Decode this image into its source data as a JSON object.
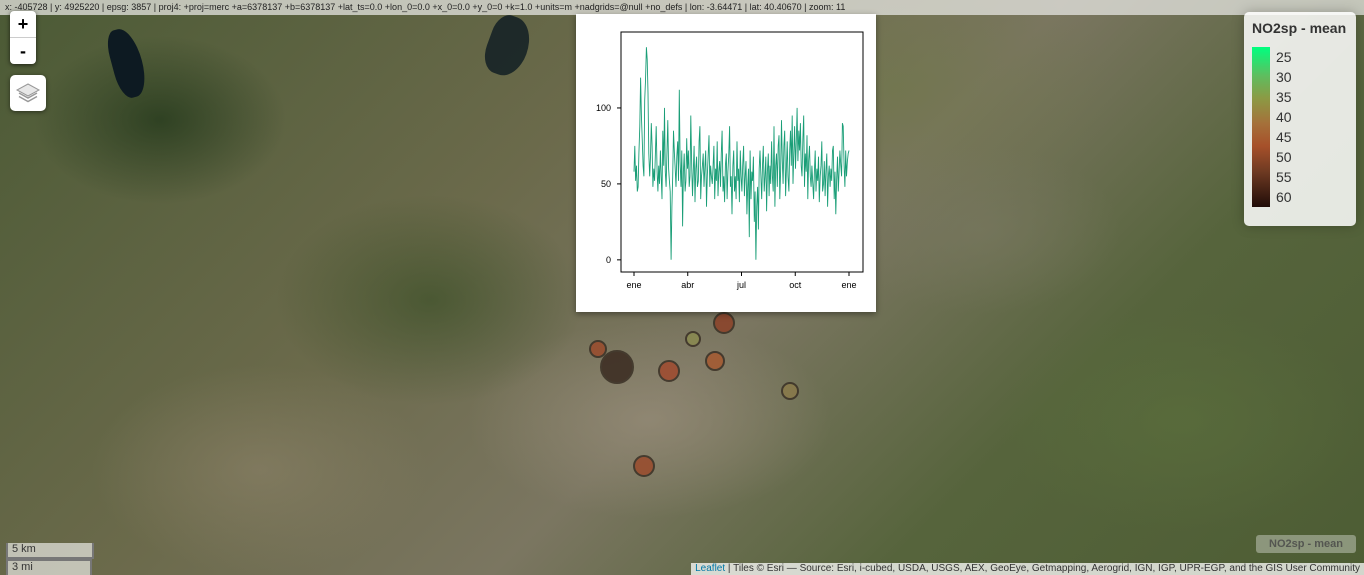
{
  "coordinates_text": "x: -405728 | y: 4925220 | epsg: 3857 | proj4: +proj=merc +a=6378137 +b=6378137 +lat_ts=0.0 +lon_0=0.0 +x_0=0.0 +y_0=0 +k=1.0 +units=m +nadgrids=@null +no_defs | lon: -3.64471 | lat: 40.40670 | zoom: 11",
  "zoom": {
    "in_label": "+",
    "out_label": "-"
  },
  "legend": {
    "title": "NO2sp - mean",
    "labels": [
      "25",
      "30",
      "35",
      "40",
      "45",
      "50",
      "55",
      "60"
    ],
    "colors": [
      "#00ff7f",
      "#5fbd5f",
      "#8c9a44",
      "#a5703a",
      "#a6502a",
      "#8a4226",
      "#4a2214",
      "#200c08"
    ]
  },
  "layer_label": "NO2sp - mean",
  "scale": {
    "km": "5 km",
    "mi": "3 mi"
  },
  "attribution": {
    "link": "Leaflet",
    "text": " | Tiles © Esri — Source: Esri, i-cubed, USDA, USGS, AEX, GeoEye, Getmapping, Aerogrid, IGN, IGP, UPR-EGP, and the GIS User Community"
  },
  "stations": [
    {
      "value": 52,
      "color": "#3a2a20"
    },
    {
      "value": 45,
      "color": "#9a4b2c"
    },
    {
      "value": 35,
      "color": "#8a8a50"
    },
    {
      "value": 44,
      "color": "#a04a2e"
    },
    {
      "value": 46,
      "color": "#8c4228"
    },
    {
      "value": 45,
      "color": "#a65a30"
    },
    {
      "value": 36,
      "color": "#8a7a4a"
    },
    {
      "value": 45,
      "color": "#9a4b2c"
    }
  ],
  "chart_data": {
    "type": "line",
    "xticks": [
      "ene",
      "abr",
      "jul",
      "oct",
      "ene"
    ],
    "yticks": [
      0,
      50,
      100
    ],
    "ylim": [
      -8,
      150
    ],
    "color": "#1a9e77",
    "values": [
      58,
      75,
      52,
      62,
      45,
      48,
      70,
      88,
      120,
      95,
      80,
      62,
      55,
      105,
      118,
      140,
      132,
      110,
      70,
      55,
      68,
      90,
      75,
      48,
      60,
      52,
      70,
      88,
      58,
      45,
      62,
      50,
      72,
      55,
      40,
      85,
      62,
      100,
      58,
      48,
      72,
      92,
      60,
      52,
      45,
      0,
      35,
      55,
      85,
      70,
      60,
      48,
      68,
      78,
      52,
      112,
      65,
      48,
      72,
      22,
      58,
      70,
      45,
      52,
      80,
      60,
      72,
      48,
      55,
      95,
      62,
      42,
      58,
      75,
      38,
      60,
      68,
      48,
      52,
      78,
      88,
      40,
      55,
      62,
      70,
      48,
      60,
      72,
      35,
      55,
      68,
      82,
      48,
      62,
      55,
      50,
      62,
      75,
      40,
      60,
      52,
      78,
      42,
      58,
      65,
      48,
      70,
      85,
      45,
      55,
      38,
      62,
      70,
      40,
      58,
      68,
      88,
      48,
      55,
      30,
      62,
      72,
      45,
      55,
      40,
      78,
      52,
      60,
      38,
      72,
      55,
      45,
      62,
      75,
      42,
      55,
      65,
      30,
      48,
      60,
      15,
      72,
      40,
      58,
      52,
      68,
      25,
      45,
      0,
      35,
      48,
      20,
      60,
      72,
      55,
      40,
      62,
      75,
      45,
      55,
      68,
      32,
      58,
      70,
      42,
      62,
      50,
      78,
      55,
      45,
      88,
      35,
      62,
      70,
      48,
      75,
      82,
      40,
      58,
      92,
      65,
      50,
      75,
      85,
      42,
      60,
      78,
      55,
      45,
      72,
      85,
      62,
      95,
      50,
      70,
      88,
      60,
      78,
      100,
      65,
      85,
      72,
      90,
      62,
      55,
      80,
      95,
      48,
      70,
      58,
      82,
      40,
      65,
      75,
      55,
      48,
      62,
      50,
      40,
      58,
      72,
      45,
      60,
      52,
      68,
      38,
      55,
      62,
      78,
      45,
      50,
      65,
      42,
      58,
      70,
      35,
      55,
      62,
      48,
      60,
      52,
      72,
      75,
      40,
      58,
      30,
      52,
      68,
      45,
      58,
      72,
      62,
      55,
      90,
      88,
      62,
      48,
      72,
      55,
      65,
      70,
      72
    ]
  }
}
